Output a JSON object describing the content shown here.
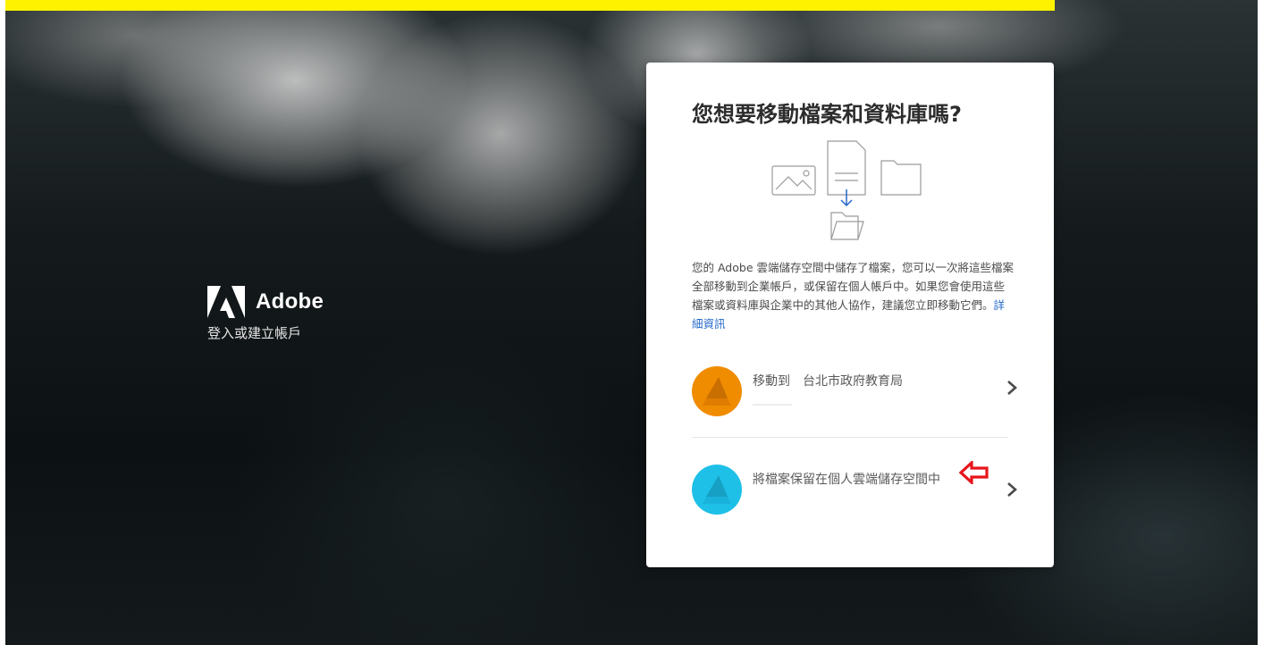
{
  "brand": {
    "name": "Adobe",
    "subtitle": "登入或建立帳戶"
  },
  "dialog": {
    "title": "您想要移動檔案和資料庫嗎?",
    "description": "您的 Adobe 雲端儲存空間中儲存了檔案，您可以一次將這些檔案全部移動到企業帳戶，或保留在個人帳戶中。如果您會使用這些檔案或資料庫與企業中的其他人協作，建議您立即移動它們。",
    "link_label": "詳細資訊",
    "options": [
      {
        "label": "移動到　台北市政府教育局",
        "avatar_color": "#f08c00",
        "icon": "chevron-right-icon"
      },
      {
        "label": "將檔案保留在個人雲端儲存空間中",
        "avatar_color": "#1ec0e8",
        "icon": "chevron-right-icon"
      }
    ]
  },
  "annotation": {
    "arrow_color": "#e8141b",
    "icon": "red-arrow-left-icon"
  },
  "colors": {
    "highlight_banner": "#fff200",
    "link": "#2468c9"
  }
}
